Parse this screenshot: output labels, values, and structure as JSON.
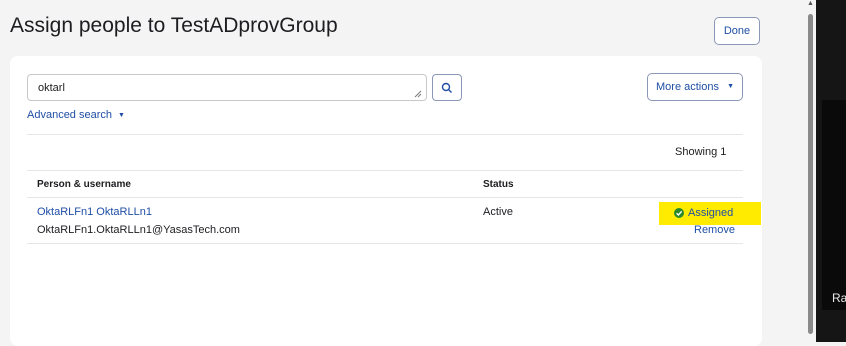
{
  "modal": {
    "title": "Assign people to TestADprovGroup",
    "done_label": "Done"
  },
  "search": {
    "value": "oktarl",
    "button_icon": "search-icon",
    "advanced_label": "Advanced search"
  },
  "actions": {
    "more_label": "More actions"
  },
  "results": {
    "showing_text": "Showing 1",
    "columns": {
      "person": "Person & username",
      "status": "Status"
    },
    "rows": [
      {
        "name": "OktaRLFn1 OktaRLLn1",
        "username": "OktaRLFn1.OktaRLLn1@YasasTech.com",
        "status": "Active",
        "assigned_label": "Assigned",
        "remove_label": "Remove"
      }
    ]
  },
  "background": {
    "partial_text": "Ra"
  },
  "colors": {
    "accent": "#1f4ea5",
    "highlight": "#ffeb00",
    "success": "#2a8a2a"
  }
}
